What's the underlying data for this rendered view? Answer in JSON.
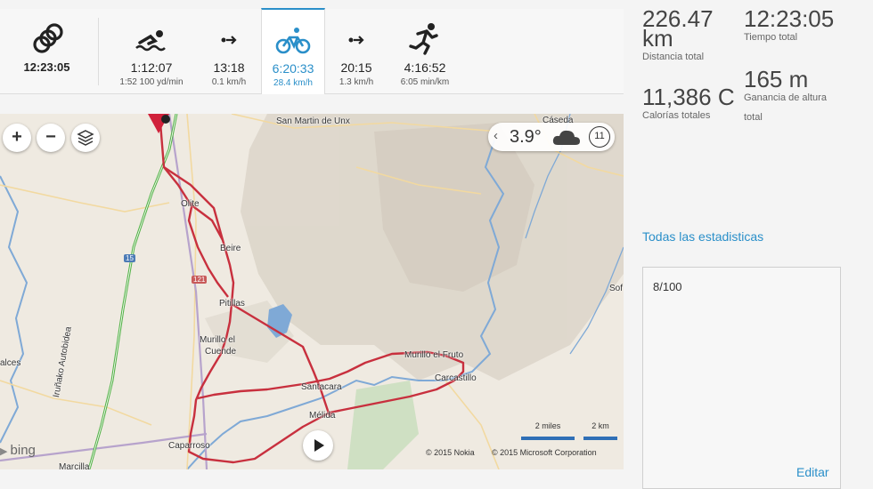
{
  "splits": [
    {
      "id": "total",
      "icon": "triathlon-rings-icon",
      "value": "12:23:05",
      "sub": ""
    },
    {
      "id": "swim",
      "icon": "swimmer-icon",
      "value": "1:12:07",
      "sub": "1:52 100 yd/min"
    },
    {
      "id": "t1",
      "icon": "transition-icon",
      "value": "13:18",
      "sub": "0.1 km/h"
    },
    {
      "id": "bike",
      "icon": "bicycle-icon",
      "value": "6:20:33",
      "sub": "28.4 km/h"
    },
    {
      "id": "t2",
      "icon": "transition-icon",
      "value": "20:15",
      "sub": "1.3 km/h"
    },
    {
      "id": "run",
      "icon": "runner-icon",
      "value": "4:16:52",
      "sub": "6:05 min/km"
    }
  ],
  "stats": {
    "distance": {
      "value": "226.47",
      "unit": "km",
      "label": "Distancia total"
    },
    "time": {
      "value": "12:23:05",
      "label": "Tiempo total"
    },
    "calories": {
      "value": "11,386 C",
      "label": "Calorías totales"
    },
    "elevation": {
      "value": "165 m",
      "label_1": "Ganancia de altura",
      "label_2": "total"
    }
  },
  "all_stats_link": "Todas las estadisticas",
  "notes": {
    "text": "8/100",
    "edit_label": "Editar"
  },
  "map": {
    "weather": {
      "temp": "3.9°",
      "wind": "11"
    },
    "places": [
      {
        "id": "san-martin",
        "text": "San Martin de Unx"
      },
      {
        "id": "olite",
        "text": "Olite"
      },
      {
        "id": "beire",
        "text": "Beire"
      },
      {
        "id": "pitillas",
        "text": "Pitillas"
      },
      {
        "id": "murillo-cuende-1",
        "text": "Murillo el"
      },
      {
        "id": "murillo-cuende-2",
        "text": "Cuende"
      },
      {
        "id": "murillo-fruto",
        "text": "Murillo el Fruto"
      },
      {
        "id": "carcastillo",
        "text": "Carcastillo"
      },
      {
        "id": "santacara",
        "text": "Santacara"
      },
      {
        "id": "melida",
        "text": "Mélida"
      },
      {
        "id": "caparroso",
        "text": "Caparroso"
      },
      {
        "id": "caseda",
        "text": "Cáseda"
      },
      {
        "id": "sof",
        "text": "Sof"
      },
      {
        "id": "alces",
        "text": "alces"
      },
      {
        "id": "marcilla",
        "text": "Marcilla"
      },
      {
        "id": "autobidea",
        "text": "Iruñako Autobidea"
      }
    ],
    "shields": [
      {
        "text": "15"
      },
      {
        "text": "121"
      }
    ],
    "scale_miles": "2 miles",
    "scale_km": "2 km",
    "copyright_nokia": "© 2015 Nokia",
    "copyright_ms": "© 2015 Microsoft Corporation",
    "bing": "bing"
  },
  "colors": {
    "accent": "#2a8fc9",
    "route": "#c8303e",
    "river": "#7fa9d6",
    "motorway": "#58b44c"
  }
}
